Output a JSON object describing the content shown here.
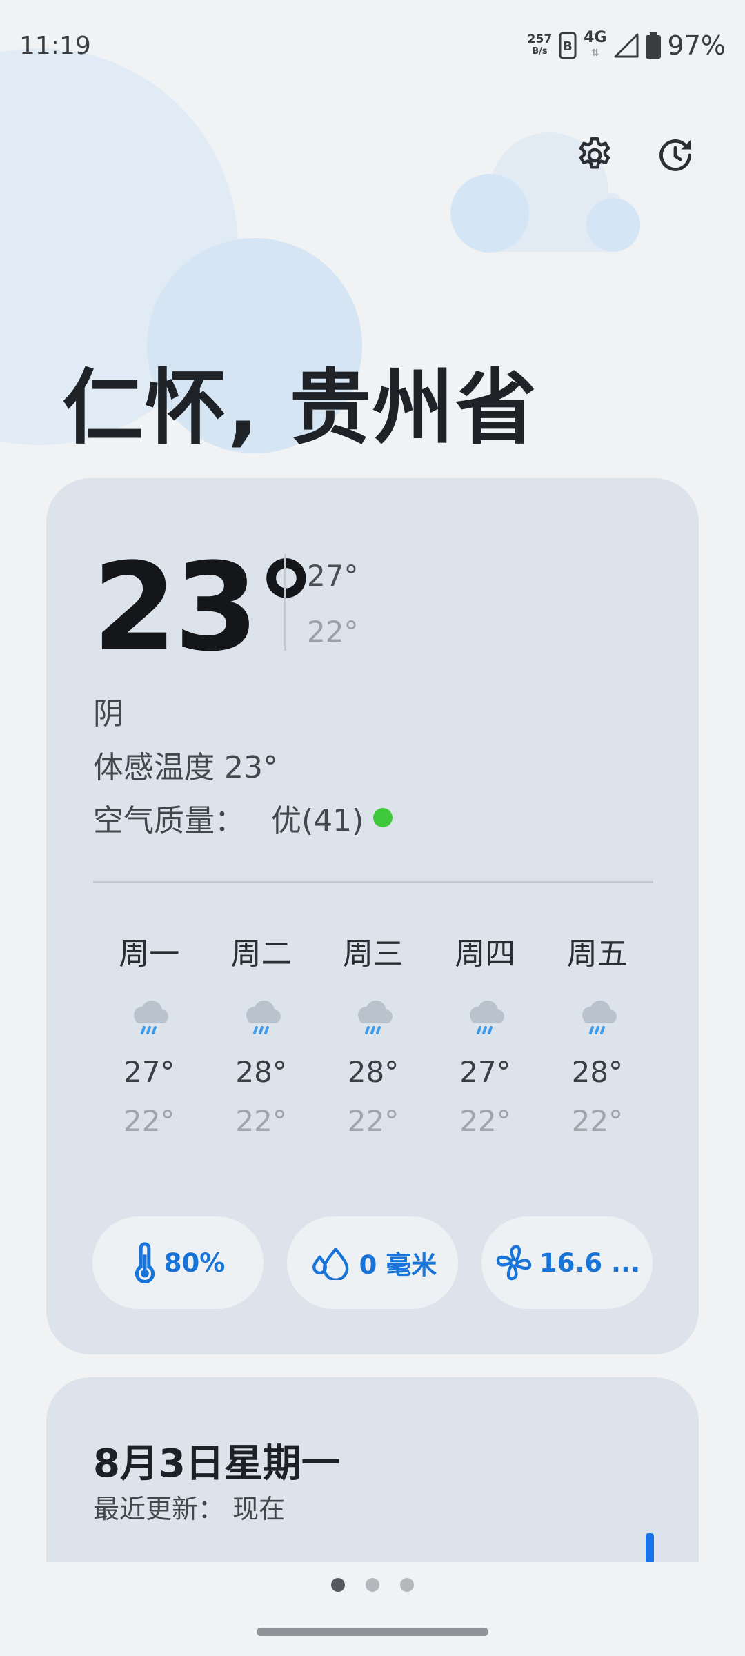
{
  "status_bar": {
    "time": "11:19",
    "net_speed_value": "257",
    "net_speed_unit": "B/s",
    "network_type": "4G",
    "battery_percent": "97%"
  },
  "location": {
    "title": "仁怀, 贵州省"
  },
  "current": {
    "temperature": "23°",
    "high": "27°",
    "low": "22°",
    "condition": "阴",
    "feels_like": "体感温度 23°",
    "aqi_label": "空气质量：",
    "aqi_value": "优(41)",
    "aqi_color": "#3fc83c"
  },
  "forecast": [
    {
      "day": "周一",
      "icon": "rain-cloud-icon",
      "high": "27°",
      "low": "22°"
    },
    {
      "day": "周二",
      "icon": "rain-cloud-icon",
      "high": "28°",
      "low": "22°"
    },
    {
      "day": "周三",
      "icon": "rain-cloud-icon",
      "high": "28°",
      "low": "22°"
    },
    {
      "day": "周四",
      "icon": "rain-cloud-icon",
      "high": "27°",
      "low": "22°"
    },
    {
      "day": "周五",
      "icon": "rain-cloud-icon",
      "high": "28°",
      "low": "22°"
    }
  ],
  "chips": {
    "humidity": "80%",
    "precipitation": "0 毫米",
    "wind": "16.6 ..."
  },
  "date_card": {
    "date": "8月3日星期一",
    "last_update": "最近更新：  现在"
  },
  "pager": {
    "active_index": 0,
    "count": 3
  },
  "colors": {
    "accent": "#1874d8",
    "card": "#dde3ea",
    "background": "#f0f2f4"
  }
}
